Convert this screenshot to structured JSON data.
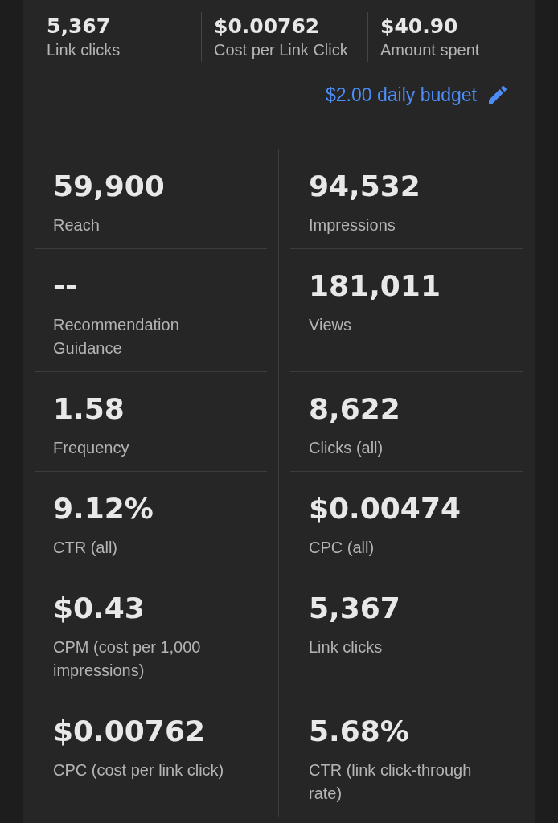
{
  "summary_stats": [
    {
      "value": "5,367",
      "label": "Link clicks"
    },
    {
      "value": "$0.00762",
      "label": "Cost per Link Click"
    },
    {
      "value": "$40.90",
      "label": "Amount spent"
    }
  ],
  "daily_budget": {
    "label": "$2.00 daily budget"
  },
  "metric_rows": [
    [
      {
        "value": "59,900",
        "label": "Reach"
      },
      {
        "value": "94,532",
        "label": "Impressions"
      }
    ],
    [
      {
        "value": "--",
        "label": "Recommendation Guidance"
      },
      {
        "value": "181,011",
        "label": "Views"
      }
    ],
    [
      {
        "value": "1.58",
        "label": "Frequency"
      },
      {
        "value": "8,622",
        "label": "Clicks (all)"
      }
    ],
    [
      {
        "value": "9.12%",
        "label": "CTR (all)"
      },
      {
        "value": "$0.00474",
        "label": "CPC (all)"
      }
    ],
    [
      {
        "value": "$0.43",
        "label": "CPM (cost per 1,000 impressions)"
      },
      {
        "value": "5,367",
        "label": "Link clicks"
      }
    ],
    [
      {
        "value": "$0.00762",
        "label": "CPC (cost per link click)"
      },
      {
        "value": "5.68%",
        "label": "CTR (link click-through rate)"
      }
    ]
  ]
}
